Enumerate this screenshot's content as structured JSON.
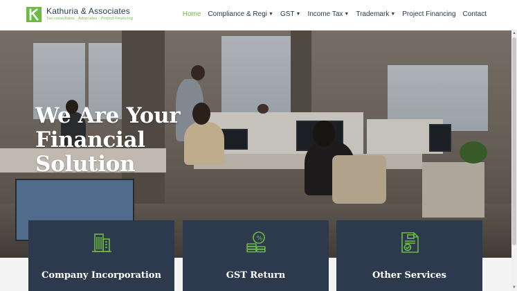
{
  "brand": {
    "name": "Kathuria & Associates",
    "tagline": "Tax consultants · Advocates · Project Financing",
    "accent_color": "#6dbb45",
    "logo_icon": "k-logo-icon"
  },
  "nav": {
    "items": [
      {
        "label": "Home",
        "active": true,
        "dropdown": false
      },
      {
        "label": "Compliance & Regi",
        "active": false,
        "dropdown": true
      },
      {
        "label": "GST",
        "active": false,
        "dropdown": true
      },
      {
        "label": "Income Tax",
        "active": false,
        "dropdown": true
      },
      {
        "label": "Trademark",
        "active": false,
        "dropdown": true
      },
      {
        "label": "Project Financing",
        "active": false,
        "dropdown": false
      },
      {
        "label": "Contact",
        "active": false,
        "dropdown": false
      }
    ],
    "dropdown_icon": "chevron-down-icon"
  },
  "hero": {
    "line1": "We Are Your",
    "line2": "Financial",
    "line3": "Solution"
  },
  "cards": [
    {
      "title": "Company Incorporation",
      "icon": "building-icon"
    },
    {
      "title": "GST Return",
      "icon": "coins-percent-icon"
    },
    {
      "title": "Other Services",
      "icon": "tax-document-icon"
    }
  ],
  "colors": {
    "card_background": "#2d3a4d",
    "nav_text": "#2b3a4a",
    "logo_text": "#1f3a4d"
  }
}
